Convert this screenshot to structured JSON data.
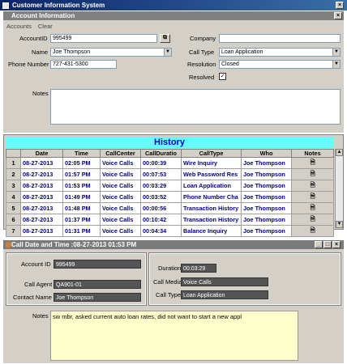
{
  "app": {
    "title": "Customer Information System"
  },
  "account_window": {
    "title": "Account Information",
    "menu": [
      "Accounts",
      "Clear"
    ],
    "account_id_label": "AccountID",
    "account_id": "995499",
    "name_label": "Name",
    "name": "Joe Thompson",
    "phone_label": "Phone Number",
    "phone": "727-431-5300",
    "company_label": "Company",
    "company": "",
    "call_type_label": "Call Type",
    "call_type": "Loan Application",
    "resolution_label": "Resolution",
    "resolution": "Closed",
    "resolved_label": "Resolved",
    "resolved_check": "✓",
    "notes_label": "Notes",
    "notes": ""
  },
  "history": {
    "title": "History",
    "columns": [
      "Date",
      "Time",
      "CallCenter",
      "CallDuratio",
      "CallType",
      "Who",
      "Notes"
    ],
    "rows": [
      {
        "n": "1",
        "date": "08-27-2013",
        "time": "02:05 PM",
        "center": "Voice Calls",
        "dur": "00:00:39",
        "type": "Wire Inquiry",
        "who": "Joe Thompson"
      },
      {
        "n": "2",
        "date": "08-27-2013",
        "time": "01:57 PM",
        "center": "Voice Calls",
        "dur": "00:07:53",
        "type": "Web Password Res",
        "who": "Joe Thompson"
      },
      {
        "n": "3",
        "date": "08-27-2013",
        "time": "01:53 PM",
        "center": "Voice Calls",
        "dur": "00:03:29",
        "type": "Loan Application",
        "who": "Joe Thompson"
      },
      {
        "n": "4",
        "date": "08-27-2013",
        "time": "01:49 PM",
        "center": "Voice Calls",
        "dur": "00:03:52",
        "type": "Phone Number Cha",
        "who": "Joe Thompson"
      },
      {
        "n": "5",
        "date": "08-27-2013",
        "time": "01:48 PM",
        "center": "Voice Calls",
        "dur": "00:00:56",
        "type": "Transaction History",
        "who": "Joe Thompson"
      },
      {
        "n": "6",
        "date": "08-27-2013",
        "time": "01:37 PM",
        "center": "Voice Calls",
        "dur": "00:10:42",
        "type": "Transaction History",
        "who": "Joe Thompson"
      },
      {
        "n": "7",
        "date": "08-27-2013",
        "time": "01:31 PM",
        "center": "Voice Calls",
        "dur": "00:04:34",
        "type": "Balance Inquiry",
        "who": "Joe Thompson"
      }
    ]
  },
  "detail_window": {
    "title": "Call Date and Time :08-27-2013 01:53 PM",
    "account_id_label": "Account ID",
    "account_id": "995499",
    "call_agent_label": "Call Agent",
    "call_agent": "QA901-01",
    "contact_name_label": "Contact Name",
    "contact_name": "Joe Thompson",
    "duration_label": "Duration",
    "duration": "00:03:29",
    "call_media_label": "Call Media",
    "call_media": "Voice Calls",
    "call_type_label": "Call Type",
    "call_type": "Loan Application",
    "notes_label": "Notes",
    "notes": "sw mbr, asked current auto loan rates, did not want to start a new appl"
  },
  "colors": {
    "history_banner": "#66ffff",
    "notes_bg": "#ffffcc",
    "panel": "#d4d0c8"
  },
  "icons": [
    "app-icon",
    "copy-icon",
    "notes-page-icon",
    "close-icon",
    "minimize-icon",
    "maximize-icon"
  ]
}
